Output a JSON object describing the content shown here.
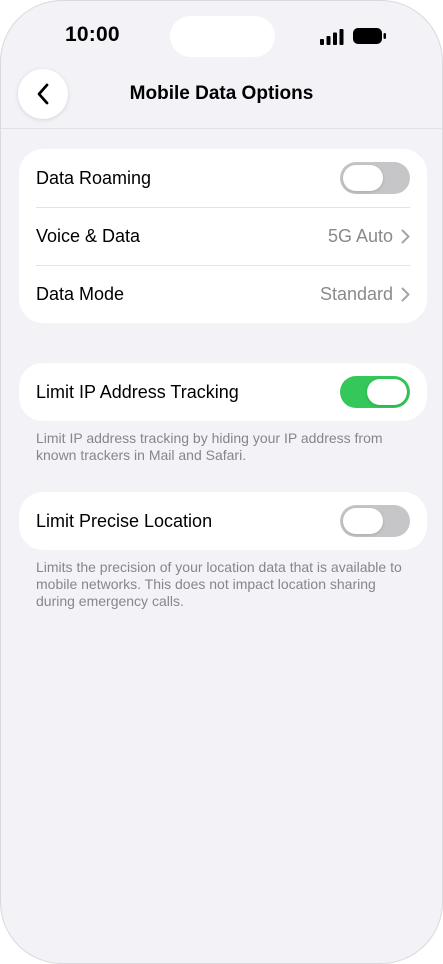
{
  "status_bar": {
    "time": "10:00",
    "signal_icon": "cellular-signal-icon",
    "battery_icon": "battery-icon"
  },
  "nav": {
    "back_icon": "chevron-left-icon",
    "title": "Mobile Data Options"
  },
  "group1": {
    "data_roaming": {
      "label": "Data Roaming",
      "toggle_on": false
    },
    "voice_data": {
      "label": "Voice & Data",
      "value": "5G Auto"
    },
    "data_mode": {
      "label": "Data Mode",
      "value": "Standard"
    }
  },
  "limit_ip": {
    "label": "Limit IP Address Tracking",
    "toggle_on": true,
    "footnote": "Limit IP address tracking by hiding your IP address from known trackers in Mail and Safari."
  },
  "limit_location": {
    "label": "Limit Precise Location",
    "toggle_on": false,
    "footnote": "Limits the precision of your location data that is available to mobile networks. This does not impact location sharing during emergency calls."
  },
  "colors": {
    "toggle_on": "#34c759",
    "toggle_off": "#c6c6c8",
    "background": "#f2f2f7",
    "secondary_text": "#8a8a8e"
  }
}
